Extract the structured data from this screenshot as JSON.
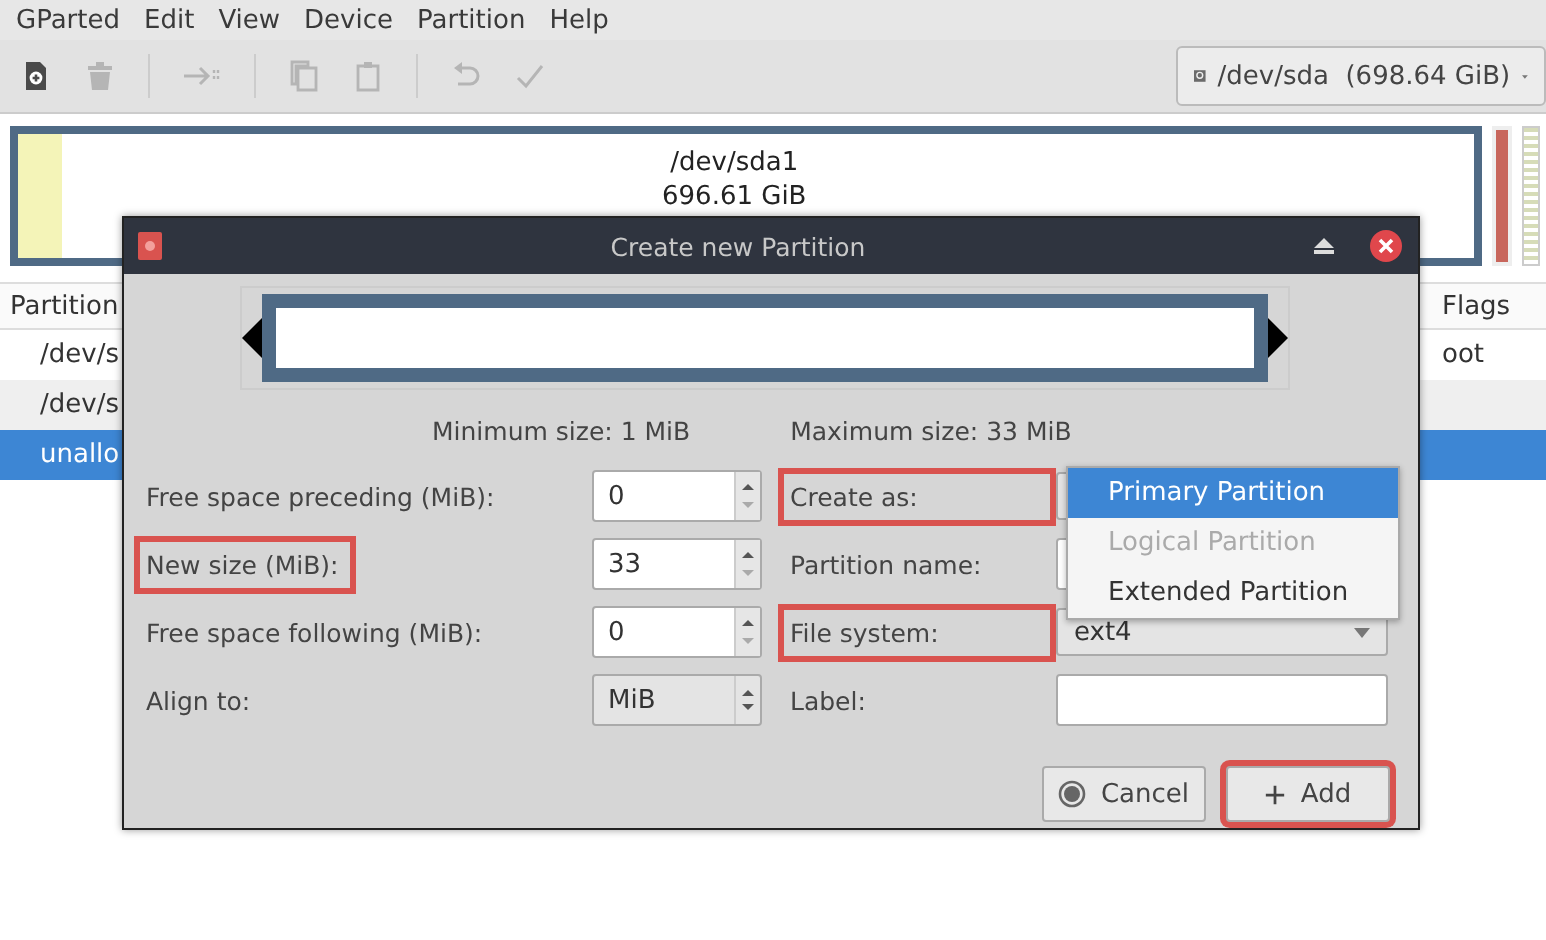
{
  "menu": [
    "GParted",
    "Edit",
    "View",
    "Device",
    "Partition",
    "Help"
  ],
  "toolbar": [
    [
      {
        "kind": "new",
        "disabled": false
      },
      {
        "kind": "delete",
        "disabled": true
      }
    ],
    [
      {
        "kind": "resize",
        "disabled": true
      }
    ],
    [
      {
        "kind": "copy",
        "disabled": true
      },
      {
        "kind": "paste",
        "disabled": true
      }
    ],
    [
      {
        "kind": "undo",
        "disabled": true
      },
      {
        "kind": "apply",
        "disabled": true
      }
    ]
  ],
  "device_selector": {
    "value": "/dev/sda  (698.64 GiB)"
  },
  "disk_map": {
    "partition_name": "/dev/sda1",
    "partition_size": "696.61 GiB"
  },
  "table": {
    "columns": [
      "Partition",
      "Flags"
    ],
    "rows": [
      {
        "partition": "/dev/s",
        "flags": "oot",
        "selected": false
      },
      {
        "partition": "/dev/s",
        "selected": false
      },
      {
        "partition": "unallo",
        "selected": true
      }
    ]
  },
  "dialog": {
    "title": "Create new Partition",
    "minimum_size": "Minimum size: 1 MiB",
    "maximum_size": "Maximum size: 33 MiB",
    "left_fields": [
      {
        "label": "Free space preceding (MiB):",
        "value": "0",
        "kind": "spin",
        "highlighted": false
      },
      {
        "label": "New size (MiB):",
        "value": "33",
        "kind": "spin",
        "highlighted": true
      },
      {
        "label": "Free space following (MiB):",
        "value": "0",
        "kind": "spin",
        "highlighted": false
      },
      {
        "label": "Align to:",
        "value": "MiB",
        "kind": "combo",
        "highlighted": false
      }
    ],
    "right_fields": [
      {
        "label": "Create as:",
        "kind": "combo",
        "highlighted": true
      },
      {
        "label": "Partition name:",
        "kind": "text",
        "highlighted": false
      },
      {
        "label": "File system:",
        "kind": "combo",
        "value": "ext4",
        "highlighted": true
      },
      {
        "label": "Label:",
        "kind": "text",
        "highlighted": false
      }
    ],
    "dropdown": [
      {
        "label": "Primary Partition",
        "selected": true,
        "disabled": false
      },
      {
        "label": "Logical Partition",
        "selected": false,
        "disabled": true
      },
      {
        "label": "Extended Partition",
        "selected": false,
        "disabled": false
      }
    ],
    "buttons": [
      {
        "label": "Cancel",
        "kind": "cancel",
        "highlighted": false
      },
      {
        "label": "Add",
        "kind": "add",
        "highlighted": true
      }
    ]
  }
}
